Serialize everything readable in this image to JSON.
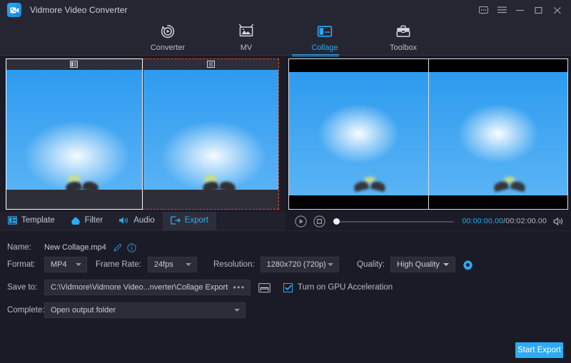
{
  "titlebar": {
    "app_title": "Vidmore Video Converter",
    "logo_icon": "video-camera-logo",
    "window_buttons": [
      {
        "name": "feedback-icon",
        "label": "Feedback"
      },
      {
        "name": "menu-icon",
        "label": "Menu"
      },
      {
        "name": "minimize-icon",
        "label": "Minimize"
      },
      {
        "name": "maximize-icon",
        "label": "Maximize"
      },
      {
        "name": "close-icon",
        "label": "Close"
      }
    ]
  },
  "nav": {
    "items": [
      {
        "label": "Converter",
        "icon": "converter-icon",
        "active": false
      },
      {
        "label": "MV",
        "icon": "mv-icon",
        "active": false
      },
      {
        "label": "Collage",
        "icon": "collage-icon",
        "active": true
      },
      {
        "label": "Toolbox",
        "icon": "toolbox-icon",
        "active": false
      }
    ]
  },
  "edit_tools": {
    "tabs": [
      {
        "label": "Template",
        "icon": "template-icon",
        "active": false
      },
      {
        "label": "Filter",
        "icon": "filter-icon",
        "active": false
      },
      {
        "label": "Audio",
        "icon": "audio-icon",
        "active": false
      },
      {
        "label": "Export",
        "icon": "export-icon",
        "active": true
      }
    ]
  },
  "collage": {
    "cells": [
      {
        "name": "collage-cell-1",
        "selected": false,
        "header_icon": "split-layout-icon"
      },
      {
        "name": "collage-cell-2",
        "selected": true,
        "header_icon": "split-layout-icon"
      }
    ],
    "selection_color": "#e2502a"
  },
  "preview": {
    "panes": [
      {
        "name": "preview-pane-left"
      },
      {
        "name": "preview-pane-right"
      }
    ]
  },
  "player": {
    "play_icon": "play-circle-icon",
    "stop_icon": "stop-square-icon",
    "volume_icon": "speaker-icon",
    "current_time": "00:00:00.00",
    "separator": "/",
    "total_time": "00:02:00.00",
    "progress_percent": 0
  },
  "export_form": {
    "name_label": "Name:",
    "name_value": "New Collage.mp4",
    "name_edit_icon": "pencil-icon",
    "name_info_icon": "info-icon",
    "format_label": "Format:",
    "format_value": "MP4",
    "frame_rate_label": "Frame Rate:",
    "frame_rate_value": "24fps",
    "resolution_label": "Resolution:",
    "resolution_value": "1280x720 (720p)",
    "quality_label": "Quality:",
    "quality_value": "High Quality",
    "settings_icon": "gear-icon",
    "save_to_label": "Save to:",
    "save_to_value": "C:\\Vidmore\\Vidmore Video...nverter\\Collage Exported",
    "browse_dots": "•••",
    "folder_icon": "folder-icon",
    "gpu_label": "Turn on GPU Acceleration",
    "gpu_checked": true,
    "complete_label": "Complete:",
    "complete_value": "Open output folder"
  },
  "actions": {
    "start_export_label": "Start Export"
  },
  "colors": {
    "accent": "#2cabf4",
    "background": "#1b1b27",
    "panel": "#262633",
    "selection": "#e2502a"
  }
}
